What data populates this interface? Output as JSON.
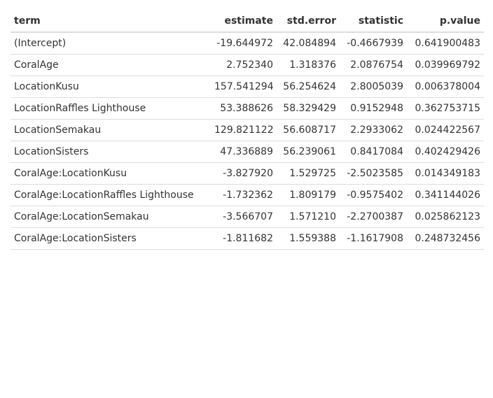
{
  "table": {
    "headers": [
      "term",
      "estimate",
      "std.error",
      "statistic",
      "p.value"
    ],
    "rows": [
      [
        "(Intercept)",
        "-19.644972",
        "42.084894",
        "-0.4667939",
        "0.641900483"
      ],
      [
        "CoralAge",
        "2.752340",
        "1.318376",
        "2.0876754",
        "0.039969792"
      ],
      [
        "LocationKusu",
        "157.541294",
        "56.254624",
        "2.8005039",
        "0.006378004"
      ],
      [
        "LocationRaffles Lighthouse",
        "53.388626",
        "58.329429",
        "0.9152948",
        "0.362753715"
      ],
      [
        "LocationSemakau",
        "129.821122",
        "56.608717",
        "2.2933062",
        "0.024422567"
      ],
      [
        "LocationSisters",
        "47.336889",
        "56.239061",
        "0.8417084",
        "0.402429426"
      ],
      [
        "CoralAge:LocationKusu",
        "-3.827920",
        "1.529725",
        "-2.5023585",
        "0.014349183"
      ],
      [
        "CoralAge:LocationRaffles Lighthouse",
        "-1.732362",
        "1.809179",
        "-0.9575402",
        "0.341144026"
      ],
      [
        "CoralAge:LocationSemakau",
        "-3.566707",
        "1.571210",
        "-2.2700387",
        "0.025862123"
      ],
      [
        "CoralAge:LocationSisters",
        "-1.811682",
        "1.559388",
        "-1.1617908",
        "0.248732456"
      ]
    ]
  }
}
